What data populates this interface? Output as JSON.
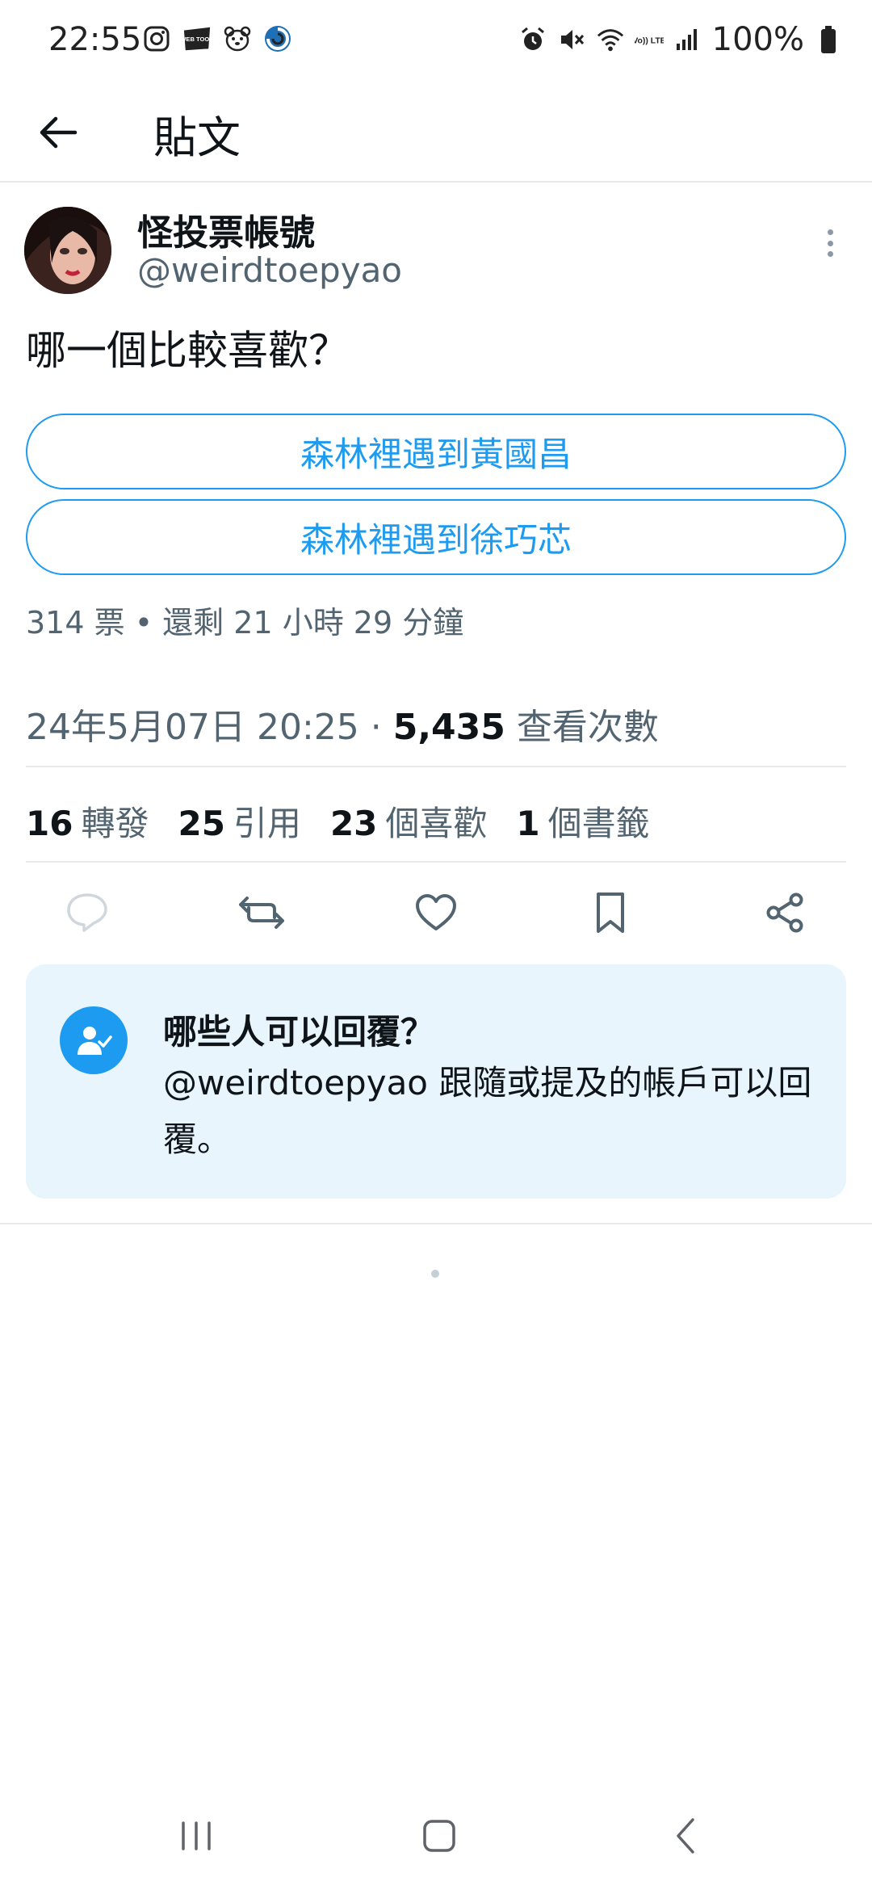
{
  "status_bar": {
    "time": "22:55",
    "battery": "100%",
    "left_icons": [
      "instagram-icon",
      "webtoon-icon",
      "bear-app-icon",
      "swirl-app-icon"
    ],
    "right_icons": [
      "alarm-icon",
      "mute-icon",
      "wifi-icon",
      "volte-icon",
      "signal-icon",
      "battery-icon"
    ],
    "webtoon_text": "WEB TOON",
    "volte_text": "Vo)) LTE"
  },
  "header": {
    "title": "貼文"
  },
  "tweet": {
    "display_name": "怪投票帳號",
    "handle": "@weirdtoepyao",
    "text": "哪一個比較喜歡？",
    "poll": {
      "options": [
        "森林裡遇到黃國昌",
        "森林裡遇到徐巧芯"
      ],
      "meta": "314 票 • 還剩 21 小時 29 分鐘"
    },
    "timestamp": "24年5月07日 20:25 · ",
    "views_count": "5,435",
    "views_label": " 查看次數",
    "stats": [
      {
        "num": "16",
        "label": "轉發"
      },
      {
        "num": "25",
        "label": "引用"
      },
      {
        "num": "23",
        "label": "個喜歡"
      },
      {
        "num": "1",
        "label": "個書籤"
      }
    ],
    "actions": [
      "reply",
      "retweet",
      "like",
      "bookmark",
      "share"
    ]
  },
  "reply_restriction": {
    "title": "哪些人可以回覆？",
    "body": "@weirdtoepyao 跟隨或提及的帳戶可以回覆。"
  },
  "colors": {
    "accent": "#1d9bf0",
    "text_primary": "#0f1419",
    "text_secondary": "#536471",
    "card_bg": "#e8f5fd",
    "divider": "#e7e9ea"
  }
}
